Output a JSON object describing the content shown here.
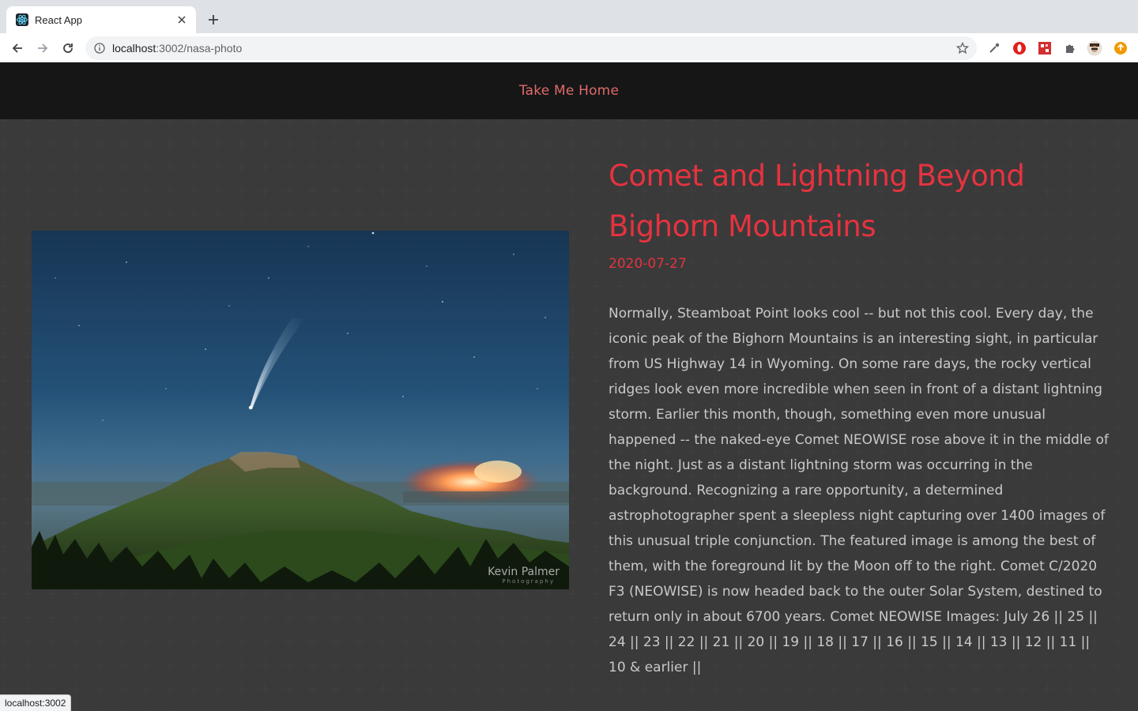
{
  "browser": {
    "tab_title": "React App",
    "url_host": "localhost",
    "url_path": ":3002/nasa-photo",
    "status_url": "localhost:3002",
    "icons": {
      "favicon": "react-logo-icon",
      "close": "close-icon",
      "new_tab": "plus-icon",
      "back": "back-arrow-icon",
      "forward": "forward-arrow-icon",
      "reload": "reload-icon",
      "site_info": "info-icon",
      "bookmark": "star-icon",
      "extensions": [
        "eyedropper-icon",
        "opera-icon",
        "red-puzzle-icon",
        "puzzle-icon",
        "avatar-icon",
        "orange-update-icon"
      ]
    }
  },
  "nav": {
    "home_link": "Take Me Home"
  },
  "apod": {
    "title": "Comet and Lightning Beyond Bighorn Mountains",
    "date": "2020-07-27",
    "explanation": "Normally, Steamboat Point looks cool -- but not this cool. Every day, the iconic peak of the Bighorn Mountains is an interesting sight, in particular from US Highway 14 in Wyoming. On some rare days, the rocky vertical ridges look even more incredible when seen in front of a distant lightning storm. Earlier this month, though, something even more unusual happened -- the naked-eye Comet NEOWISE rose above it in the middle of the night. Just as a distant lightning storm was occurring in the background. Recognizing a rare opportunity, a determined astrophotographer spent a sleepless night capturing over 1400 images of this unusual triple conjunction. The featured image is among the best of them, with the foreground lit by the Moon off to the right. Comet C/2020 F3 (NEOWISE) is now headed back to the outer Solar System, destined to return only in about 6700 years. Comet NEOWISE Images: July 26 || 25 || 24 || 23 || 22 || 21 || 20 || 19 || 18 || 17 || 16 || 15 || 14 || 13 || 12 || 11 || 10 & earlier ||",
    "watermark": "Kevin Palmer",
    "watermark_sub": "Photography"
  },
  "colors": {
    "accent": "#e5333f",
    "link": "#e06a6a",
    "text": "#c9c9c9",
    "background": "#1f1f1f",
    "navbar": "#161616"
  }
}
